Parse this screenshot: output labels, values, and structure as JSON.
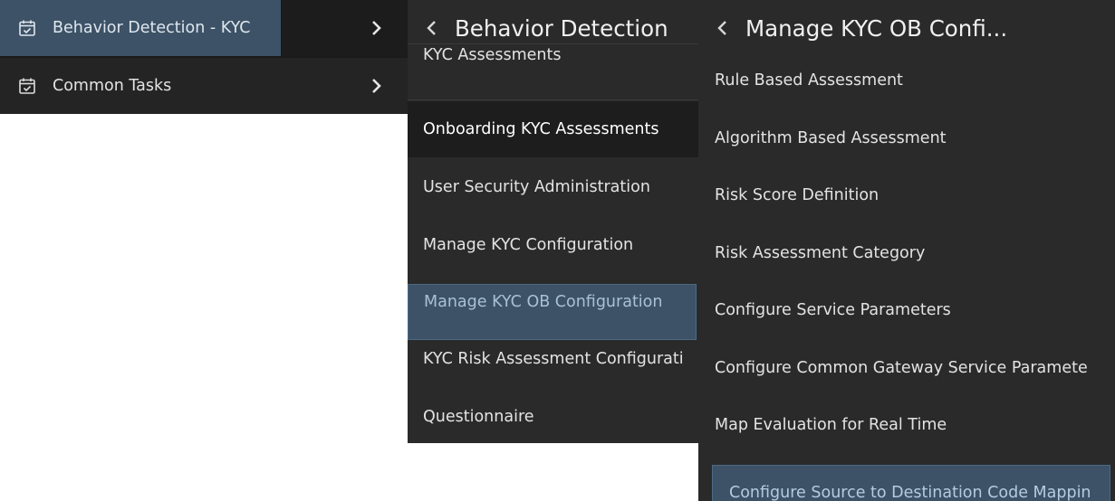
{
  "main_menu": {
    "items": [
      {
        "label": "Behavior Detection - KYC",
        "icon": "calendar-check-icon",
        "selected": true
      },
      {
        "label": "Common Tasks",
        "icon": "calendar-check-icon",
        "selected": false
      }
    ]
  },
  "submenu": {
    "title": "Behavior Detection",
    "items": [
      {
        "label": "KYC Assessments"
      },
      {
        "label": "Onboarding KYC Assessments"
      },
      {
        "label": "User Security Administration"
      },
      {
        "label": "Manage KYC Configuration"
      },
      {
        "label": "Manage KYC OB Configuration"
      },
      {
        "label": "KYC Risk Assessment Configurati"
      },
      {
        "label": "Questionnaire"
      }
    ]
  },
  "config_menu": {
    "title": "Manage KYC OB Confi...",
    "items": [
      {
        "label": "Rule Based Assessment"
      },
      {
        "label": "Algorithm Based Assessment"
      },
      {
        "label": "Risk Score Definition"
      },
      {
        "label": "Risk Assessment Category"
      },
      {
        "label": "Configure Service Parameters"
      },
      {
        "label": "Configure Common Gateway Service Paramete"
      },
      {
        "label": "Map Evaluation for Real Time"
      },
      {
        "label": "Configure Source to Destination Code Mappin"
      }
    ]
  },
  "colors": {
    "panel_bg": "#2a2a2a",
    "selected_bg": "#3d5266",
    "text": "#e3e3e3"
  }
}
